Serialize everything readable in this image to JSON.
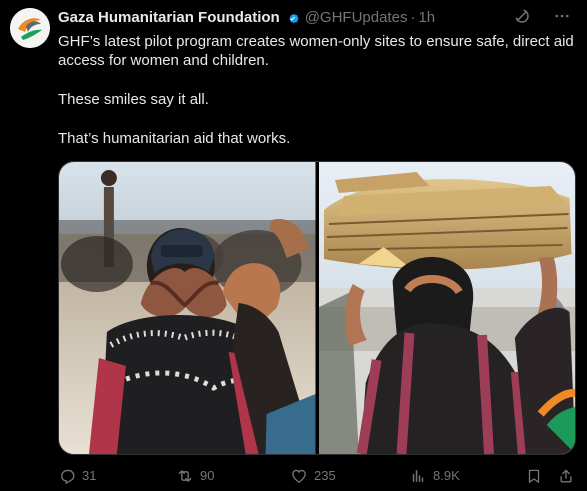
{
  "post": {
    "author_name": "Gaza Humanitarian Foundation",
    "handle": "@GHFUpdates",
    "separator": "·",
    "time": "1h",
    "paragraphs": [
      "GHF’s latest pilot program creates women-only sites to ensure safe, direct aid access for women and children.",
      "These smiles say it all.",
      "That’s humanitarian aid that works."
    ]
  },
  "actions": {
    "replies": "31",
    "reposts": "90",
    "likes": "235",
    "views": "8.9K"
  },
  "icons": {
    "avatar": "ghf-logo",
    "verified": "verified-badge-icon",
    "grok": "grok-icon",
    "more": "more-icon",
    "reply": "reply-icon",
    "repost": "repost-icon",
    "like": "heart-icon",
    "views": "views-icon",
    "bookmark": "bookmark-icon",
    "share": "share-icon"
  },
  "colors": {
    "background": "#000000",
    "text_primary": "#e7e9ea",
    "text_secondary": "#71767b",
    "verified_blue": "#1d9bf0",
    "logo_orange": "#f08a24",
    "logo_green": "#18a05a"
  }
}
